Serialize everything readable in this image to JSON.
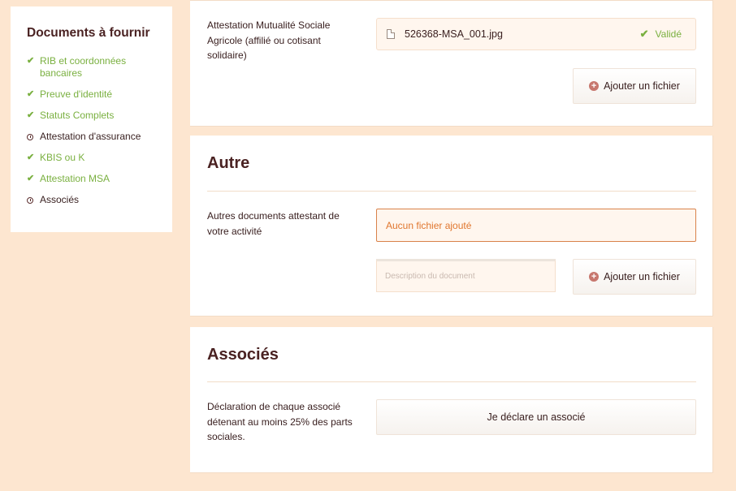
{
  "sidebar": {
    "title": "Documents à fournir",
    "items": [
      {
        "label": "RIB et coordonnées bancaires",
        "status": "ok"
      },
      {
        "label": "Preuve d'identité",
        "status": "ok"
      },
      {
        "label": "Statuts Complets",
        "status": "ok"
      },
      {
        "label": "Attestation d'assurance",
        "status": "pending"
      },
      {
        "label": "KBIS ou K",
        "status": "ok"
      },
      {
        "label": "Attestation MSA",
        "status": "ok"
      },
      {
        "label": "Associés",
        "status": "pending"
      }
    ]
  },
  "msa_section": {
    "label": "Attestation Mutualité Sociale Agricole (affilié ou cotisant solidaire)",
    "file_name": "526368-MSA_001.jpg",
    "file_status": "Validé",
    "add_button": "Ajouter un fichier"
  },
  "autre_section": {
    "title": "Autre",
    "label": "Autres documents attestant de votre activité",
    "no_file_text": "Aucun fichier ajouté",
    "description_placeholder": "Description du document",
    "add_button": "Ajouter un fichier"
  },
  "associes_section": {
    "title": "Associés",
    "label": "Déclaration de chaque associé détenant au moins 25% des parts sociales.",
    "declare_button": "Je déclare un associé"
  },
  "colors": {
    "background": "#fde6d0",
    "valid_green": "#7ab040",
    "warning_orange": "#e0762e",
    "heading": "#4a2222",
    "plus_icon": "#c7776e"
  }
}
